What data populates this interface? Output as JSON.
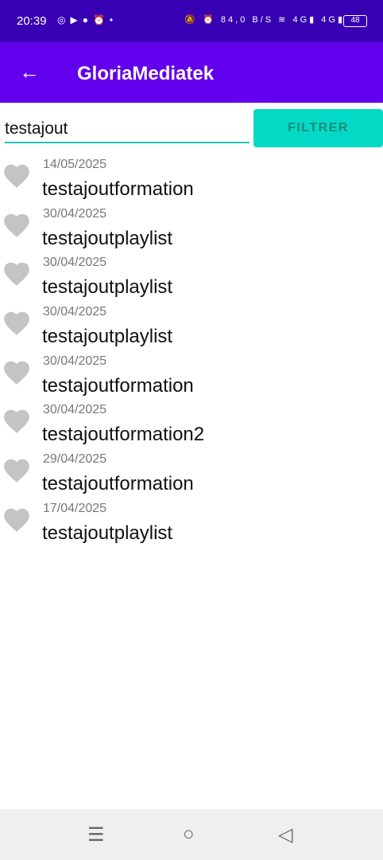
{
  "status_bar": {
    "time": "20:39",
    "left_icons": [
      "instagram-icon",
      "youtube-icon",
      "chat-icon",
      "alarm-icon",
      "dot-icon"
    ],
    "right_icons": [
      "bell-off-icon",
      "alarm-icon",
      "net-speed",
      "wifi-icon",
      "signal-4g-icon",
      "signal-4g-icon"
    ],
    "net_speed": "84,0 B/S",
    "network": "4G",
    "battery": "48"
  },
  "app_bar": {
    "title": "GloriaMediatek"
  },
  "search": {
    "value": "testajout"
  },
  "filter_label": "FILTRER",
  "items": [
    {
      "date": "14/05/2025",
      "title": "testajoutformation"
    },
    {
      "date": "30/04/2025",
      "title": "testajoutplaylist"
    },
    {
      "date": "30/04/2025",
      "title": "testajoutplaylist"
    },
    {
      "date": "30/04/2025",
      "title": "testajoutplaylist"
    },
    {
      "date": "30/04/2025",
      "title": "testajoutformation"
    },
    {
      "date": "30/04/2025",
      "title": "testajoutformation2"
    },
    {
      "date": "29/04/2025",
      "title": "testajoutformation"
    },
    {
      "date": "17/04/2025",
      "title": "testajoutplaylist"
    }
  ],
  "colors": {
    "status": "#3700b3",
    "appbar": "#6200ee",
    "accent": "#03dac5",
    "heart": "#c4c4c4"
  }
}
